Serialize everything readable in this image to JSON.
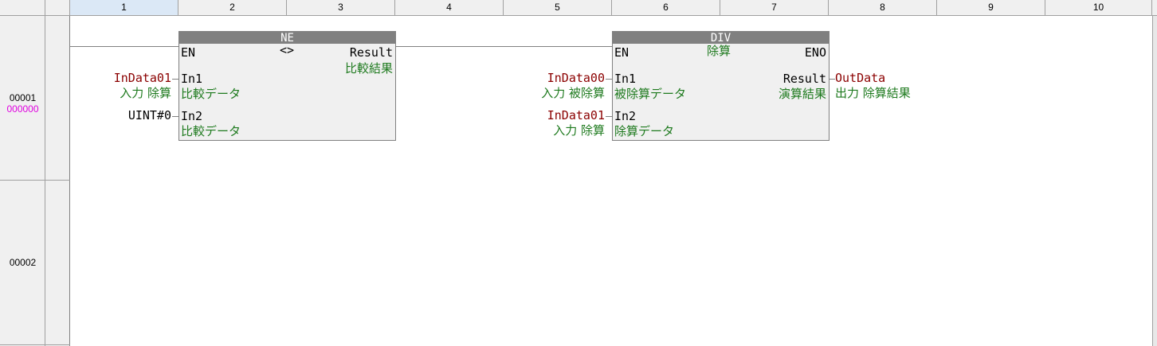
{
  "columns": [
    "1",
    "2",
    "3",
    "4",
    "5",
    "6",
    "7",
    "8",
    "9",
    "10"
  ],
  "rungs": [
    {
      "number": "00001",
      "address": "000000"
    },
    {
      "number": "00002"
    }
  ],
  "blocks": {
    "ne": {
      "name": "NE",
      "symbol": "<>",
      "en": "EN",
      "out_pin": "Result",
      "out_comment": "比較結果",
      "in1": "In1",
      "in1_comment": "比較データ",
      "in2": "In2",
      "in2_comment": "比較データ",
      "in1_var": "InData01",
      "in1_var_comment": "入力 除算",
      "in2_var": "UINT#0"
    },
    "div": {
      "name": "DIV",
      "comment": "除算",
      "en": "EN",
      "eno": "ENO",
      "out_pin": "Result",
      "out_comment": "演算結果",
      "in1": "In1",
      "in1_comment": "被除算データ",
      "in2": "In2",
      "in2_comment": "除算データ",
      "in1_var": "InData00",
      "in1_var_comment": "入力 被除算",
      "in2_var": "InData01",
      "in2_var_comment": "入力 除算",
      "out_var": "OutData",
      "out_var_comment": "出力 除算結果"
    }
  }
}
